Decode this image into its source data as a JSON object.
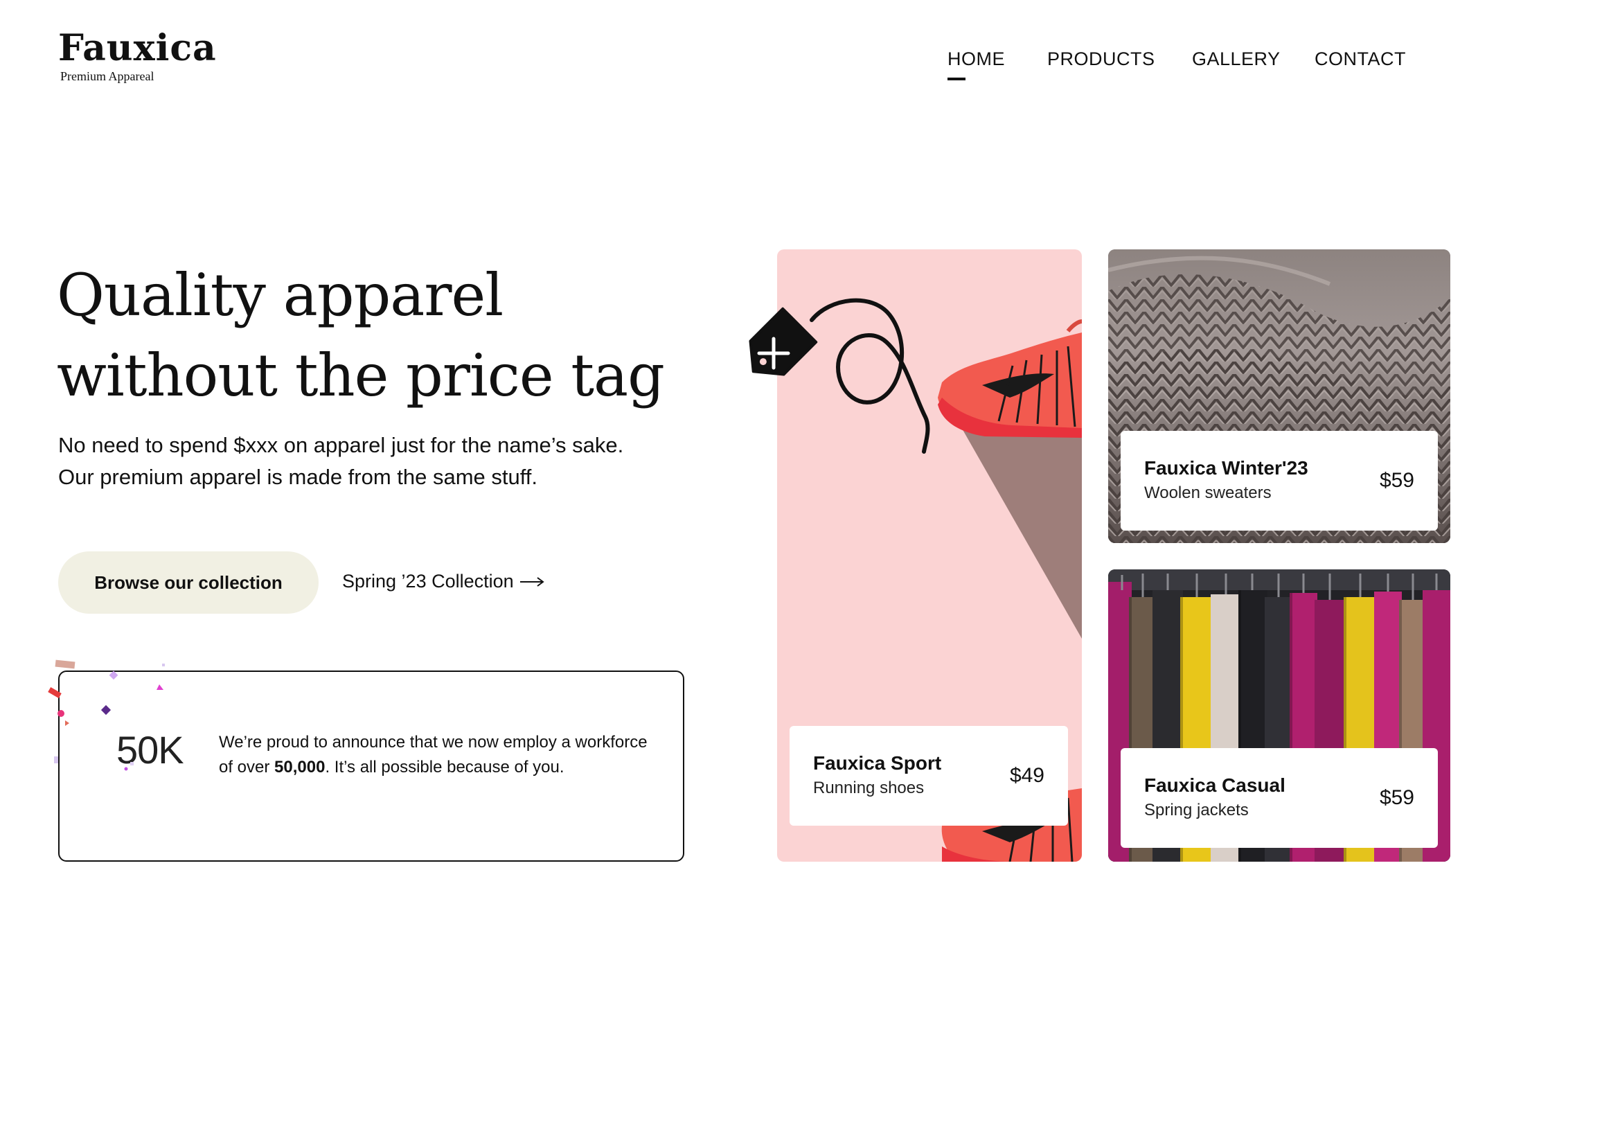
{
  "brand": {
    "name": "Fauxica",
    "tagline": "Premium Appareal"
  },
  "nav": {
    "items": [
      {
        "label": "HOME",
        "active": true
      },
      {
        "label": "PRODUCTS",
        "active": false
      },
      {
        "label": "GALLERY",
        "active": false
      },
      {
        "label": "CONTACT",
        "active": false
      }
    ]
  },
  "hero": {
    "headline_line1": "Quality apparel",
    "headline_line2": "without the price tag",
    "subtext_line1": "No need to spend $xxx on apparel just for the name’s sake.",
    "subtext_line2": "Our premium apparel is made from the same stuff.",
    "cta_label": "Browse our collection",
    "link_label": "Spring ’23 Collection"
  },
  "stat": {
    "value": "50K",
    "text_before": "We’re proud to announce that we now employ a workforce of over ",
    "text_bold": "50,000",
    "text_after": ". It’s all possible because of you."
  },
  "products": [
    {
      "name": "Fauxica Sport",
      "subtitle": "Running shoes",
      "price": "$49"
    },
    {
      "name": "Fauxica Winter'23",
      "subtitle": "Woolen sweaters",
      "price": "$59"
    },
    {
      "name": "Fauxica Casual",
      "subtitle": "Spring jackets",
      "price": "$59"
    }
  ],
  "colors": {
    "accent_button": "#f1f0e3",
    "sport_card_bg": "#fbd3d3",
    "sneaker": "#f25a4f",
    "text": "#111111"
  },
  "icons": [
    "price-tag-plus-icon",
    "arrow-right-icon",
    "confetti-decoration"
  ]
}
